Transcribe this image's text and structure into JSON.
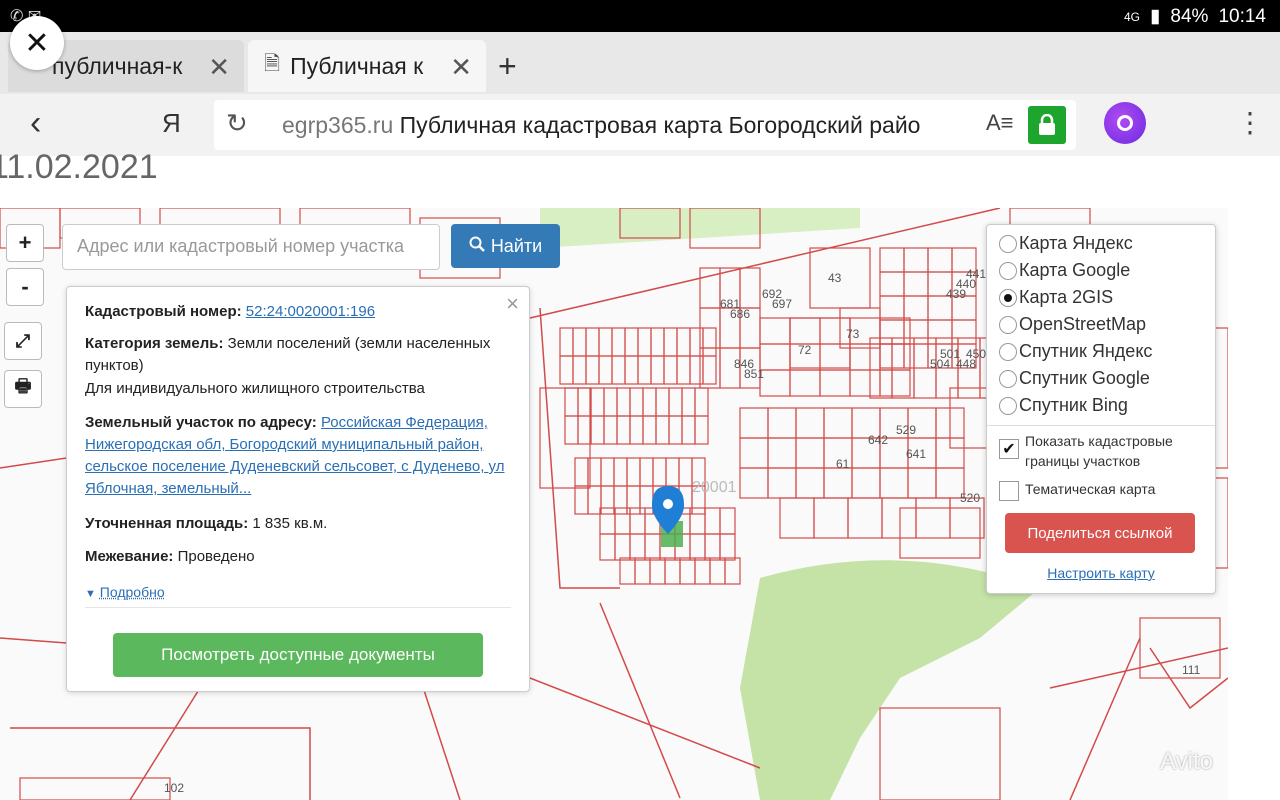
{
  "status_bar": {
    "left_icons": "✆ ✉",
    "network": "4G",
    "battery": "84%",
    "time": "10:14"
  },
  "tabs": [
    {
      "label": "публичная-к",
      "active": false
    },
    {
      "label": "Публичная к",
      "active": true
    }
  ],
  "new_tab_label": "+",
  "close_overlay": "✕",
  "toolbar": {
    "back": "‹",
    "yandex": "Я",
    "reload": "↻",
    "url_domain": "egrp365.ru",
    "url_title": "Публичная кадастровая карта Богородский райо",
    "reader": "A≡",
    "menu": "⋮"
  },
  "page": {
    "date": "11.02.2021"
  },
  "map_controls": {
    "zoom_in": "+",
    "zoom_out": "-",
    "fullscreen": "⤢",
    "print": "🖶"
  },
  "search": {
    "placeholder": "Адрес или кадастровый номер участка",
    "button": "Найти"
  },
  "info": {
    "cadastral_label": "Кадастровый номер:",
    "cadastral_value": "52:24:0020001:196",
    "category_label": "Категория земель:",
    "category_value": "Земли поселений (земли населенных пунктов)",
    "usage": "Для индивидуального жилищного строительства",
    "address_label": "Земельный участок по адресу:",
    "address_value": "Российская Федерация, Нижегородская обл, Богородский муниципальный район, сельское поселение Дуденевский сельсовет, с Дуденево, ул Яблочная, земельный...",
    "area_label": "Уточненная площадь:",
    "area_value": "1 835 кв.м.",
    "survey_label": "Межевание:",
    "survey_value": "Проведено",
    "more": "Подробно",
    "docs_button": "Посмотреть доступные документы",
    "close": "×"
  },
  "layers": {
    "options": [
      {
        "label": "Карта Яндекс",
        "selected": false
      },
      {
        "label": "Карта Google",
        "selected": false
      },
      {
        "label": "Карта 2GIS",
        "selected": true
      },
      {
        "label": "OpenStreetMap",
        "selected": false
      },
      {
        "label": "Спутник Яндекс",
        "selected": false
      },
      {
        "label": "Спутник Google",
        "selected": false
      },
      {
        "label": "Спутник Bing",
        "selected": false
      }
    ],
    "show_boundaries": "Показать кадастровые границы участков",
    "show_boundaries_checked": true,
    "thematic": "Тематическая карта",
    "thematic_checked": false,
    "share": "Поделиться ссылкой",
    "configure": "Настроить карту"
  },
  "map_labels": [
    "43",
    "73",
    "72",
    "61",
    "111",
    "102",
    "20001",
    "520",
    "642",
    "641",
    "529",
    "450",
    "448",
    "504",
    "501",
    "439",
    "440",
    "441",
    "692",
    "697",
    "681",
    "686",
    "846",
    "851"
  ],
  "watermarks": {
    "avito": "Avito"
  },
  "colors": {
    "parcel": "#d24a4a",
    "green_area": "#c5e3a7",
    "marker": "#1f7fd6",
    "selected_parcel": "#4caf50"
  }
}
